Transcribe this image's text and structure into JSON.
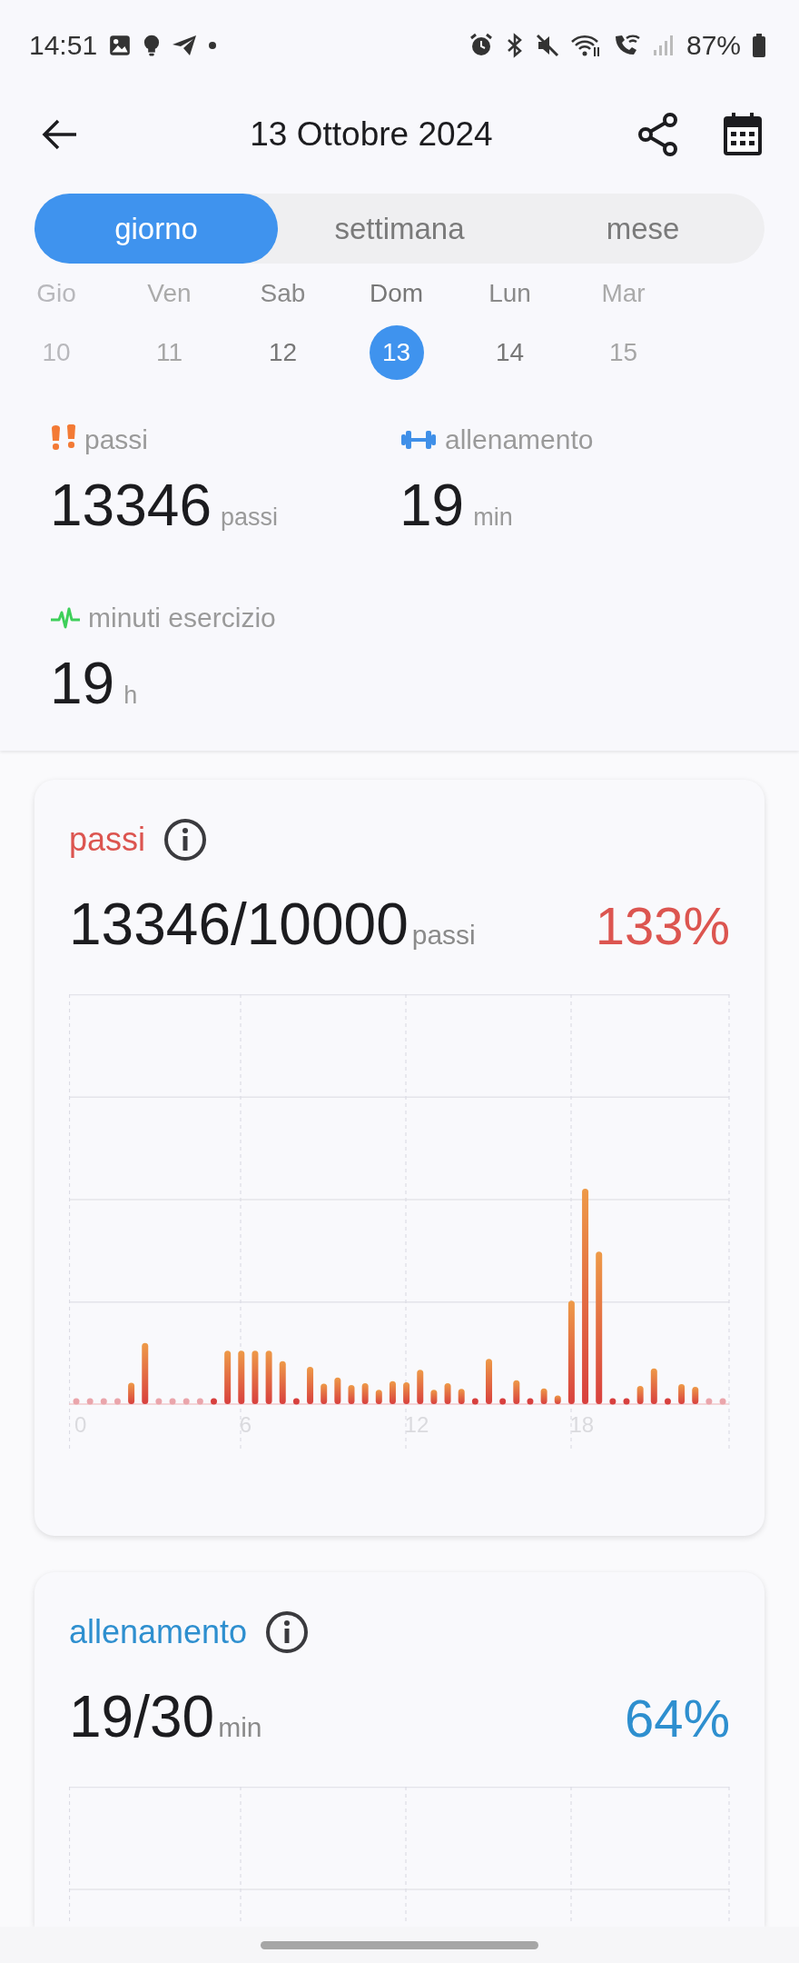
{
  "status_bar": {
    "time": "14:51",
    "battery": "87%"
  },
  "header": {
    "title": "13 Ottobre 2024"
  },
  "tabs": [
    {
      "label": "giorno",
      "selected": true
    },
    {
      "label": "settimana",
      "selected": false
    },
    {
      "label": "mese",
      "selected": false
    }
  ],
  "days": [
    {
      "weekday": "Gio",
      "date": "10",
      "selected": false
    },
    {
      "weekday": "Ven",
      "date": "11",
      "selected": false
    },
    {
      "weekday": "Sab",
      "date": "12",
      "selected": false
    },
    {
      "weekday": "Dom",
      "date": "13",
      "selected": true
    },
    {
      "weekday": "Lun",
      "date": "14",
      "selected": false
    },
    {
      "weekday": "Mar",
      "date": "15",
      "selected": false
    }
  ],
  "summary": [
    {
      "kind": "steps",
      "label": "passi",
      "value": "13346",
      "unit": "passi"
    },
    {
      "kind": "workout",
      "label": "allenamento",
      "value": "19",
      "unit": "min"
    },
    {
      "kind": "exercise",
      "label": "minuti esercizio",
      "value": "19",
      "unit": "h"
    }
  ],
  "cards": [
    {
      "kind": "steps",
      "title": "passi",
      "value": "13346/10000",
      "unit": "passi",
      "percent": "133%",
      "color": "#dc5550",
      "x_labels": [
        "0",
        "6",
        "12",
        "18"
      ]
    },
    {
      "kind": "workout",
      "title": "allenamento",
      "value": "19/30",
      "unit": "min",
      "percent": "64%",
      "color": "#2e8fcf"
    }
  ]
}
